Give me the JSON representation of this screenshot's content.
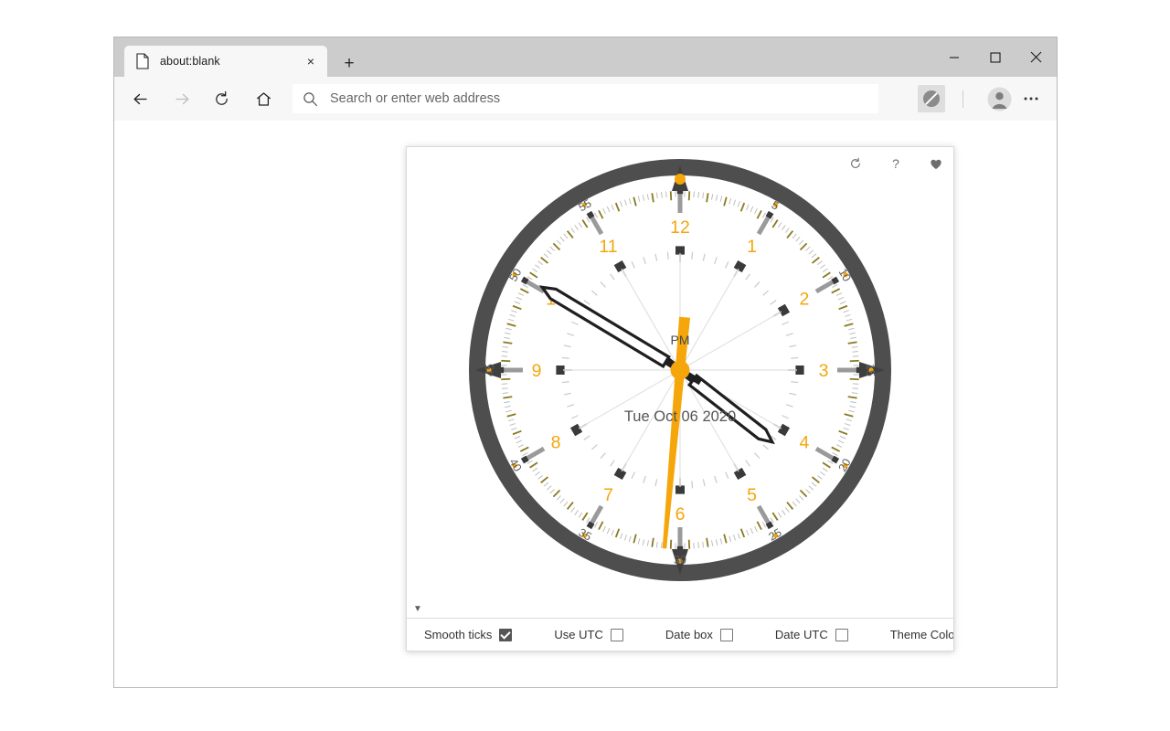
{
  "window": {
    "minimize_label": "Minimize",
    "maximize_label": "Maximize",
    "close_label": "Close"
  },
  "tab": {
    "title": "about:blank",
    "close_label": "×",
    "new_tab_label": "+"
  },
  "toolbar": {
    "back_label": "Back",
    "forward_label": "Forward",
    "reload_label": "Refresh",
    "home_label": "Home",
    "address_placeholder": "Search or enter web address",
    "address_value": "",
    "block_label": "Blocked",
    "profile_label": "Profile",
    "more_label": "Settings and more"
  },
  "panel": {
    "tools": [
      {
        "name": "refresh-icon",
        "label": "↻"
      },
      {
        "name": "help-icon",
        "label": "?"
      },
      {
        "name": "favorite-icon",
        "label": "♥"
      }
    ],
    "expander_label": "▼",
    "controls": [
      {
        "label": "Smooth ticks",
        "checked": true,
        "type": "checkbox"
      },
      {
        "label": "Use UTC",
        "checked": false,
        "type": "checkbox"
      },
      {
        "label": "Date box",
        "checked": false,
        "type": "checkbox"
      },
      {
        "label": "Date UTC",
        "checked": false,
        "type": "checkbox"
      },
      {
        "label": "Theme Color",
        "checked": false,
        "type": "swatch",
        "color": "#F5A60A"
      }
    ]
  },
  "clock": {
    "meridiem": "PM",
    "date_text": "Tue Oct 06 2020",
    "hour_numerals": [
      "12",
      "1",
      "2",
      "3",
      "4",
      "5",
      "6",
      "7",
      "8",
      "9",
      "10",
      "11"
    ],
    "minute_labels": [
      "5",
      "10",
      "15",
      "20",
      "25",
      "30",
      "35",
      "40",
      "45",
      "50",
      "55"
    ],
    "hands": {
      "hour_angle": 128,
      "minute_angle": 301,
      "second_angle": 185
    },
    "colors": {
      "accent": "#F5A60A",
      "bezel": "#4E4E4E",
      "hand": "#1F1F1F",
      "face": "#FFFFFF",
      "tick_major": "#3A3A3A",
      "tick_minor": "#BDBDBD",
      "tick_olive": "#8A7A1E",
      "date_text": "#555555"
    }
  }
}
